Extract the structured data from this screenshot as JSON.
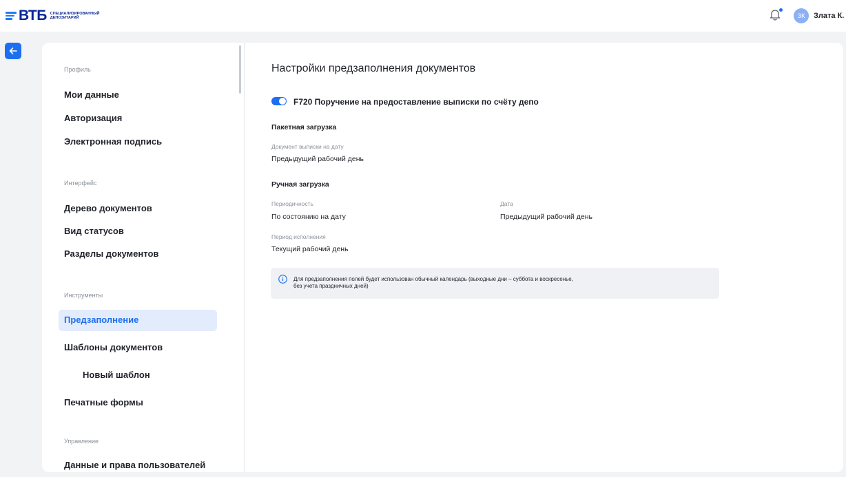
{
  "header": {
    "logo_main": "ВТБ",
    "logo_sub_line1": "СПЕЦИАЛИЗИРОВАННЫЙ",
    "logo_sub_line2": "ДЕПОЗИТАРИЙ",
    "avatar_initials": "ЗК",
    "user_name": "Злата К.",
    "icons": {
      "bell": "bell-icon",
      "back": "arrow-left-icon"
    },
    "accent_color": "#1d6ff0"
  },
  "sidebar": {
    "sections": [
      {
        "label": "Профиль",
        "items": [
          "Мои данные",
          "Авторизация",
          "Электронная подпись"
        ]
      },
      {
        "label": "Интерфейс",
        "items": [
          "Дерево документов",
          "Вид статусов",
          "Разделы документов"
        ]
      },
      {
        "label": "Инструменты",
        "items": [
          "Предзаполнение",
          "Шаблоны документов",
          "Новый шаблон",
          "Печатные формы"
        ]
      },
      {
        "label": "Управление",
        "items": [
          "Данные и права пользователей"
        ]
      }
    ],
    "active_item": "Предзаполнение"
  },
  "main": {
    "title": "Настройки предзаполнения документов",
    "toggle": {
      "label": "F720 Поручение на предоставление выписки по счёту депо",
      "enabled": true
    },
    "batch": {
      "heading": "Пакетная загрузка",
      "statement_date_label": "Документ выписки на дату",
      "statement_date_value": "Предыдущий рабочий день"
    },
    "manual": {
      "heading": "Ручная загрузка",
      "periodicity_label": "Периодичность",
      "periodicity_value": "По состоянию на дату",
      "date_label": "Дата",
      "date_value": "Предыдущий рабочий день",
      "period_label": "Период исполнения",
      "period_value": "Текущий рабочий день"
    },
    "info": {
      "icon": "info-icon",
      "line1": "Для предзаполнения полей будет использован обычный календарь (выходные дни – суббота и воскресенье,",
      "line2": "без учета праздничных дней)"
    }
  }
}
